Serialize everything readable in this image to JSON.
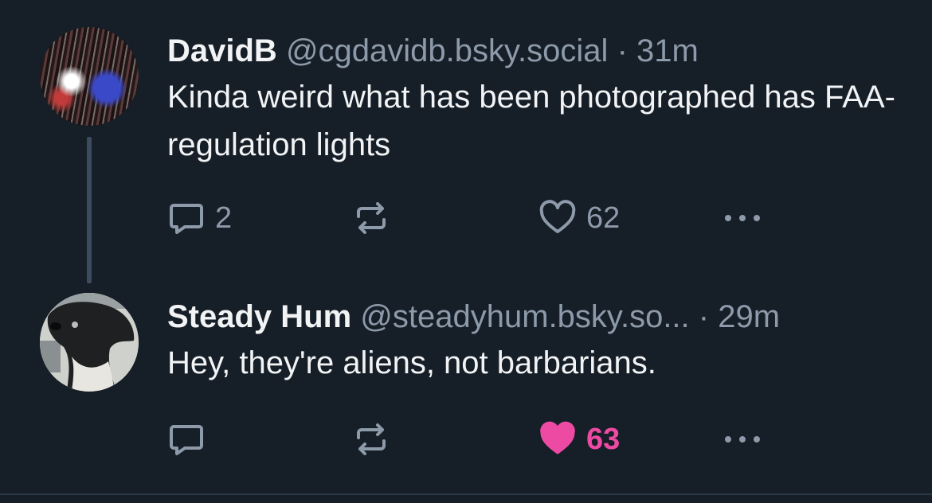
{
  "posts": [
    {
      "display_name": "DavidB",
      "handle": "@cgdavidb.bsky.social",
      "time": "· 31m",
      "text": "Kinda weird what has been photographed has FAA-regulation lights",
      "reply_count": "2",
      "like_count": "62",
      "liked": false
    },
    {
      "display_name": "Steady Hum",
      "handle": "@steadyhum.bsky.so...",
      "time": "· 29m",
      "text": "Hey, they're aliens, not barbarians.",
      "reply_count": "",
      "like_count": "63",
      "liked": true
    }
  ],
  "colors": {
    "background": "#161e27",
    "muted_text": "#8d9aaa",
    "primary_text": "#f1f3f5",
    "like_active": "#ec4aa3",
    "thread_line": "#3c4c5e"
  },
  "icons": [
    "reply-icon",
    "repost-icon",
    "like-icon",
    "more-icon"
  ]
}
